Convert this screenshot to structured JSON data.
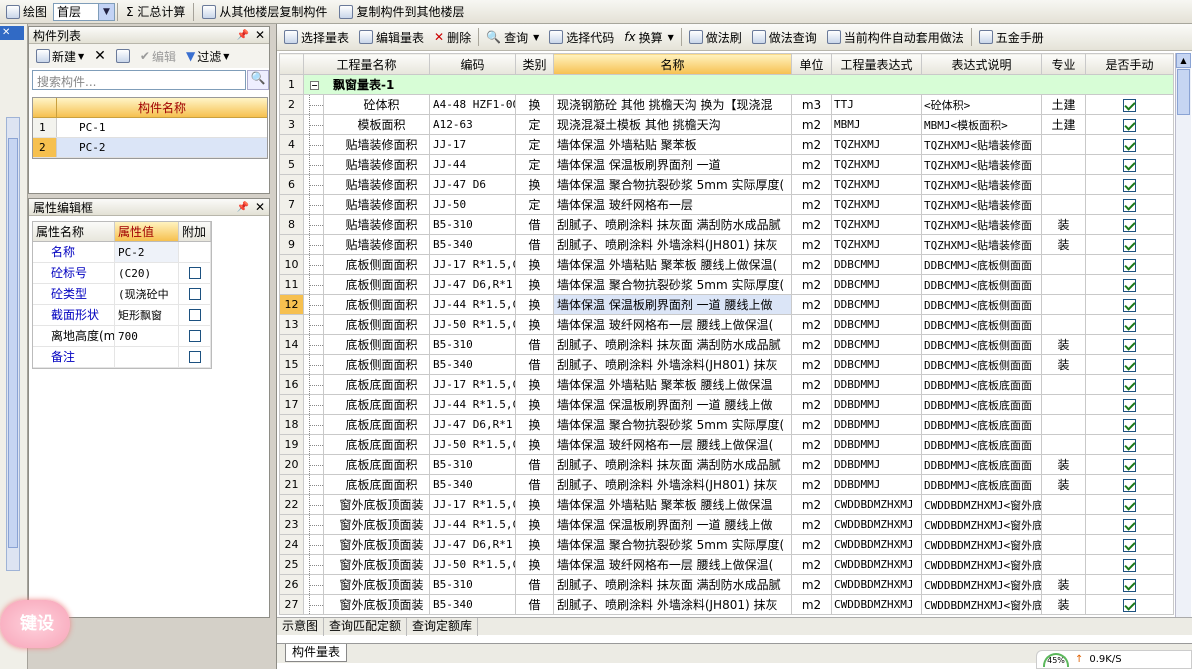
{
  "topbar": {
    "draw_label": "绘图",
    "floor_value": "首层",
    "sum_label": "Σ 汇总计算",
    "copy_from_label": "从其他楼层复制构件",
    "copy_to_label": "复制构件到其他楼层"
  },
  "leftstrip": {
    "close": "✕"
  },
  "component_list": {
    "title": "构件列表",
    "new_label": "新建",
    "edit_label": "编辑",
    "filter_label": "过滤",
    "search_placeholder": "搜索构件...",
    "column_header": "构件名称",
    "items": [
      {
        "num": "1",
        "name": "PC-1"
      },
      {
        "num": "2",
        "name": "PC-2"
      }
    ]
  },
  "property_editor": {
    "title": "属性编辑框",
    "headers": [
      "属性名称",
      "属性值",
      "附加"
    ],
    "rows": [
      {
        "name": "名称",
        "value": "PC-2"
      },
      {
        "name": "砼标号",
        "value": "(C20)"
      },
      {
        "name": "砼类型",
        "value": "(现浇砼中"
      },
      {
        "name": "截面形状",
        "value": "矩形飘窗"
      },
      {
        "name": "离地高度(m",
        "value": "700"
      },
      {
        "name": "备注",
        "value": ""
      }
    ]
  },
  "floating_badge": "键设",
  "main_toolbar": {
    "select_list": "选择量表",
    "edit_list": "编辑量表",
    "delete": "删除",
    "query": "查询",
    "select_code": "选择代码",
    "convert": "换算",
    "method_brush": "做法刷",
    "method_query": "做法查询",
    "auto_apply": "当前构件自动套用做法",
    "hardware": "五金手册"
  },
  "table": {
    "headers": [
      "工程量名称",
      "编码",
      "类别",
      "名称",
      "单位",
      "工程量表达式",
      "表达式说明",
      "专业",
      "是否手动"
    ],
    "group_row": {
      "num": "1",
      "title": "飘窗量表-1"
    },
    "rows": [
      {
        "num": "2",
        "name": "砼体积",
        "code": "A4-48 HZF1-00",
        "type": "换",
        "desc": "现浇钢筋砼 其他 挑檐天沟 换为【现浇混",
        "unit": "m3",
        "expr": "TTJ",
        "note": "<砼体积>",
        "major": "土建"
      },
      {
        "num": "3",
        "name": "模板面积",
        "code": "A12-63",
        "type": "定",
        "desc": "现浇混凝土模板 其他 挑檐天沟",
        "unit": "m2",
        "expr": "MBMJ",
        "note": "MBMJ<模板面积>",
        "major": "土建"
      },
      {
        "num": "4",
        "name": "贴墙装修面积",
        "code": "JJ-17",
        "type": "定",
        "desc": "墙体保温 外墙粘贴 聚苯板",
        "unit": "m2",
        "expr": "TQZHXMJ",
        "note": "TQZHXMJ<贴墙装修面",
        "major": ""
      },
      {
        "num": "5",
        "name": "贴墙装修面积",
        "code": "JJ-44",
        "type": "定",
        "desc": "墙体保温 保温板刷界面剂 一道",
        "unit": "m2",
        "expr": "TQZHXMJ",
        "note": "TQZHXMJ<贴墙装修面",
        "major": ""
      },
      {
        "num": "6",
        "name": "贴墙装修面积",
        "code": "JJ-47 D6",
        "type": "换",
        "desc": "墙体保温 聚合物抗裂砂浆 5mm 实际厚度(",
        "unit": "m2",
        "expr": "TQZHXMJ",
        "note": "TQZHXMJ<贴墙装修面",
        "major": ""
      },
      {
        "num": "7",
        "name": "贴墙装修面积",
        "code": "JJ-50",
        "type": "定",
        "desc": "墙体保温 玻纤网格布一层",
        "unit": "m2",
        "expr": "TQZHXMJ",
        "note": "TQZHXMJ<贴墙装修面",
        "major": ""
      },
      {
        "num": "8",
        "name": "贴墙装修面积",
        "code": "B5-310",
        "type": "借",
        "desc": "刮腻子、喷刷涂料 抹灰面 满刮防水成品腻",
        "unit": "m2",
        "expr": "TQZHXMJ",
        "note": "TQZHXMJ<贴墙装修面",
        "major": "装"
      },
      {
        "num": "9",
        "name": "贴墙装修面积",
        "code": "B5-340",
        "type": "借",
        "desc": "刮腻子、喷刷涂料 外墙涂料(JH801) 抹灰",
        "unit": "m2",
        "expr": "TQZHXMJ",
        "note": "TQZHXMJ<贴墙装修面",
        "major": "装"
      },
      {
        "num": "10",
        "name": "底板侧面面积",
        "code": "JJ-17 R*1.5,C",
        "type": "换",
        "desc": "墙体保温 外墙粘贴 聚苯板 腰线上做保温(",
        "unit": "m2",
        "expr": "DDBCMMJ",
        "note": "DDBCMMJ<底板侧面面",
        "major": ""
      },
      {
        "num": "11",
        "name": "底板侧面面积",
        "code": "JJ-47 D6,R*1.",
        "type": "换",
        "desc": "墙体保温 聚合物抗裂砂浆 5mm 实际厚度(",
        "unit": "m2",
        "expr": "DDBCMMJ",
        "note": "DDBCMMJ<底板侧面面",
        "major": ""
      },
      {
        "num": "12",
        "name": "底板侧面面积",
        "code": "JJ-44 R*1.5,C",
        "type": "换",
        "desc": "墙体保温 保温板刷界面剂 一道 腰线上做",
        "unit": "m2",
        "expr": "DDBCMMJ",
        "note": "DDBCMMJ<底板侧面面",
        "major": "",
        "selected": true
      },
      {
        "num": "13",
        "name": "底板侧面面积",
        "code": "JJ-50 R*1.5,C",
        "type": "换",
        "desc": "墙体保温 玻纤网格布一层 腰线上做保温(",
        "unit": "m2",
        "expr": "DDBCMMJ",
        "note": "DDBCMMJ<底板侧面面",
        "major": ""
      },
      {
        "num": "14",
        "name": "底板侧面面积",
        "code": "B5-310",
        "type": "借",
        "desc": "刮腻子、喷刷涂料 抹灰面 满刮防水成品腻",
        "unit": "m2",
        "expr": "DDBCMMJ",
        "note": "DDBCMMJ<底板侧面面",
        "major": "装"
      },
      {
        "num": "15",
        "name": "底板侧面面积",
        "code": "B5-340",
        "type": "借",
        "desc": "刮腻子、喷刷涂料 外墙涂料(JH801) 抹灰",
        "unit": "m2",
        "expr": "DDBCMMJ",
        "note": "DDBCMMJ<底板侧面面",
        "major": "装"
      },
      {
        "num": "16",
        "name": "底板底面面积",
        "code": "JJ-17 R*1.5,C",
        "type": "换",
        "desc": "墙体保温 外墙粘贴 聚苯板 腰线上做保温",
        "unit": "m2",
        "expr": "DDBDMMJ",
        "note": "DDBDMMJ<底板底面面",
        "major": ""
      },
      {
        "num": "17",
        "name": "底板底面面积",
        "code": "JJ-44 R*1.5,C",
        "type": "换",
        "desc": "墙体保温 保温板刷界面剂 一道 腰线上做",
        "unit": "m2",
        "expr": "DDBDMMJ",
        "note": "DDBDMMJ<底板底面面",
        "major": ""
      },
      {
        "num": "18",
        "name": "底板底面面积",
        "code": "JJ-47 D6,R*1.",
        "type": "换",
        "desc": "墙体保温 聚合物抗裂砂浆 5mm 实际厚度(",
        "unit": "m2",
        "expr": "DDBDMMJ",
        "note": "DDBDMMJ<底板底面面",
        "major": ""
      },
      {
        "num": "19",
        "name": "底板底面面积",
        "code": "JJ-50 R*1.5,C",
        "type": "换",
        "desc": "墙体保温 玻纤网格布一层 腰线上做保温(",
        "unit": "m2",
        "expr": "DDBDMMJ",
        "note": "DDBDMMJ<底板底面面",
        "major": ""
      },
      {
        "num": "20",
        "name": "底板底面面积",
        "code": "B5-310",
        "type": "借",
        "desc": "刮腻子、喷刷涂料 抹灰面 满刮防水成品腻",
        "unit": "m2",
        "expr": "DDBDMMJ",
        "note": "DDBDMMJ<底板底面面",
        "major": "装"
      },
      {
        "num": "21",
        "name": "底板底面面积",
        "code": "B5-340",
        "type": "借",
        "desc": "刮腻子、喷刷涂料 外墙涂料(JH801) 抹灰",
        "unit": "m2",
        "expr": "DDBDMMJ",
        "note": "DDBDMMJ<底板底面面",
        "major": "装"
      },
      {
        "num": "22",
        "name": "窗外底板顶面装",
        "code": "JJ-17 R*1.5,C",
        "type": "换",
        "desc": "墙体保温 外墙粘贴 聚苯板 腰线上做保温",
        "unit": "m2",
        "expr": "CWDDBDMZHXMJ",
        "note": "CWDDBDMZHXMJ<窗外底",
        "major": ""
      },
      {
        "num": "23",
        "name": "窗外底板顶面装",
        "code": "JJ-44 R*1.5,C",
        "type": "换",
        "desc": "墙体保温 保温板刷界面剂 一道 腰线上做",
        "unit": "m2",
        "expr": "CWDDBDMZHXMJ",
        "note": "CWDDBDMZHXMJ<窗外底",
        "major": ""
      },
      {
        "num": "24",
        "name": "窗外底板顶面装",
        "code": "JJ-47 D6,R*1.",
        "type": "换",
        "desc": "墙体保温 聚合物抗裂砂浆 5mm 实际厚度(",
        "unit": "m2",
        "expr": "CWDDBDMZHXMJ",
        "note": "CWDDBDMZHXMJ<窗外底",
        "major": ""
      },
      {
        "num": "25",
        "name": "窗外底板顶面装",
        "code": "JJ-50 R*1.5,C",
        "type": "换",
        "desc": "墙体保温 玻纤网格布一层 腰线上做保温(",
        "unit": "m2",
        "expr": "CWDDBDMZHXMJ",
        "note": "CWDDBDMZHXMJ<窗外底",
        "major": ""
      },
      {
        "num": "26",
        "name": "窗外底板顶面装",
        "code": "B5-310",
        "type": "借",
        "desc": "刮腻子、喷刷涂料 抹灰面 满刮防水成品腻",
        "unit": "m2",
        "expr": "CWDDBDMZHXMJ",
        "note": "CWDDBDMZHXMJ<窗外底",
        "major": "装"
      },
      {
        "num": "27",
        "name": "窗外底板顶面装",
        "code": "B5-340",
        "type": "借",
        "desc": "刮腻子、喷刷涂料 外墙涂料(JH801) 抹灰",
        "unit": "m2",
        "expr": "CWDDBDMZHXMJ",
        "note": "CWDDBDMZHXMJ<窗外底",
        "major": "装"
      }
    ]
  },
  "bottom_tabs": [
    "示意图",
    "查询匹配定额",
    "查询定额库"
  ],
  "doc_tab": "构件量表",
  "net_meter": {
    "percent": "45%",
    "speed": "0.9K/S"
  },
  "colors": {
    "accent": "#f6c04f",
    "group_row": "#d7fdd6",
    "selection": "#dbe5f7"
  }
}
